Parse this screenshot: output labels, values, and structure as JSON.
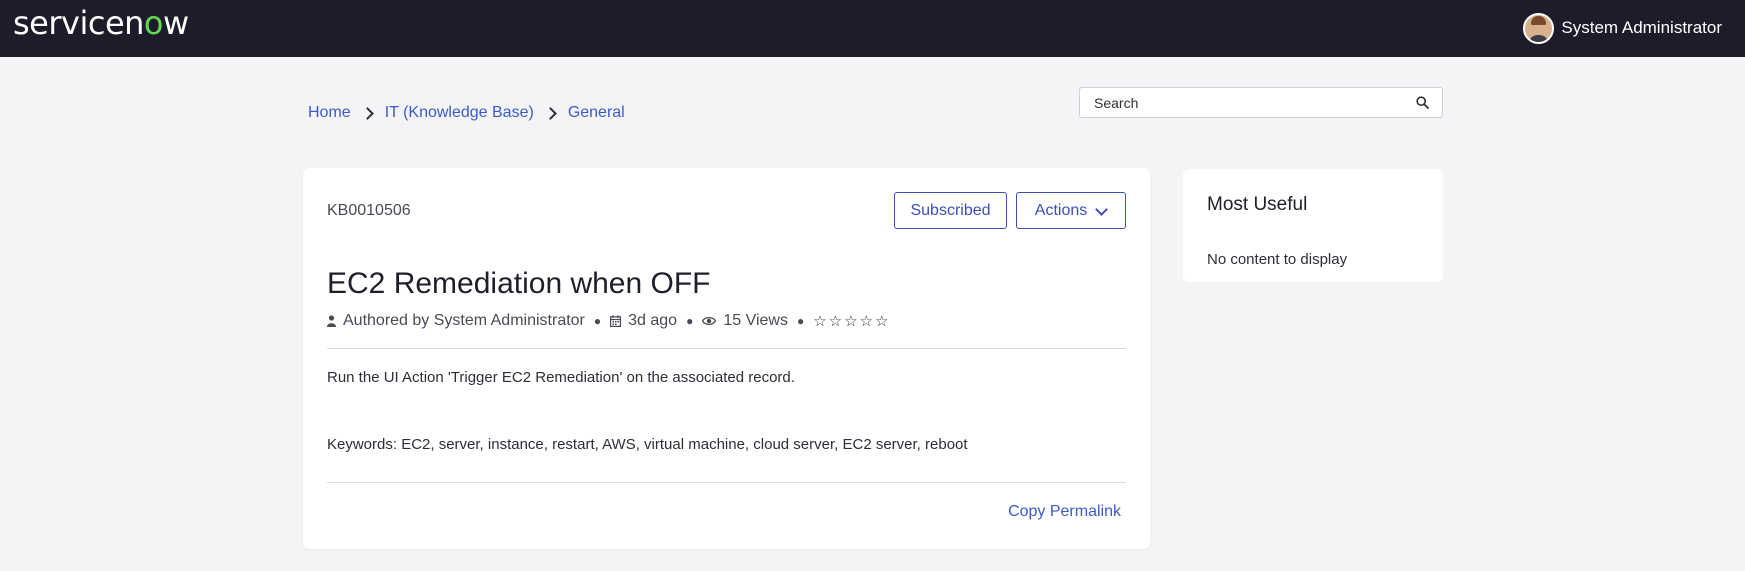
{
  "header": {
    "logo": {
      "before": "servicen",
      "o": "o",
      "after": "w"
    },
    "user_name": "System Administrator"
  },
  "breadcrumb": [
    "Home",
    "IT (Knowledge Base)",
    "General"
  ],
  "search": {
    "placeholder": "Search"
  },
  "article": {
    "number": "KB0010506",
    "subscribe_label": "Subscribed",
    "actions_label": "Actions",
    "title": "EC2 Remediation when OFF",
    "author": "Authored by System Administrator",
    "age": "3d ago",
    "views": "15 Views",
    "rating": "☆☆☆☆☆",
    "body": "Run the UI Action 'Trigger EC2 Remediation' on the associated record.",
    "keywords": "Keywords: EC2, server, instance, restart, AWS, virtual machine, cloud server, EC2 server, reboot",
    "permalink_label": "Copy Permalink"
  },
  "sidebar": {
    "title": "Most Useful",
    "empty_text": "No content to display"
  },
  "colors": {
    "topbar": "#1c1c2b",
    "link": "#3b5bc9",
    "accent": "#3b4fb8",
    "background": "#f4f4f6"
  },
  "icons": [
    "search-icon",
    "user-icon",
    "calendar-icon",
    "eye-icon",
    "chevron-down-icon",
    "chevron-right-icon"
  ]
}
